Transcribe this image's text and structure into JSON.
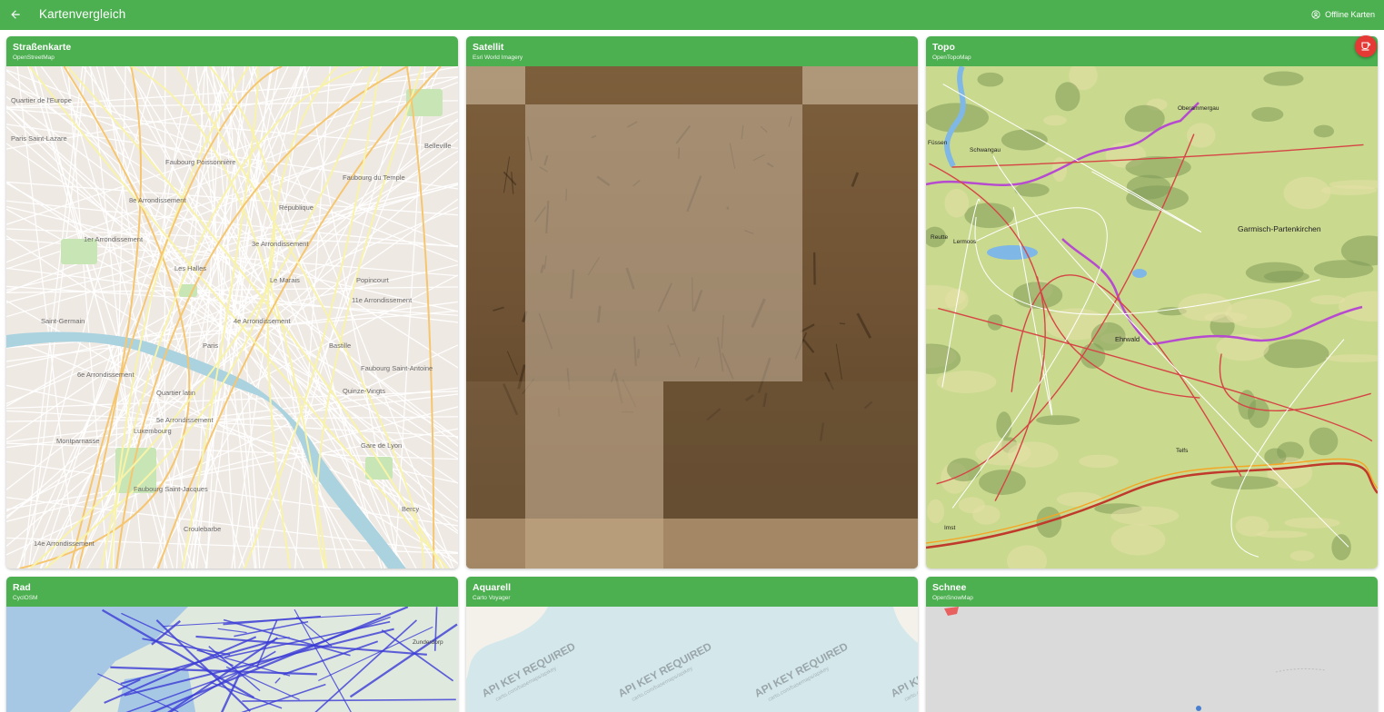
{
  "appbar": {
    "title": "Kartenvergleich",
    "action_label": "Offline Karten",
    "back_icon": "arrow-left-icon",
    "action_icon": "account-circle-icon",
    "color": "#4caf50"
  },
  "fab": {
    "icon": "coffee-cup-icon",
    "color": "#e53935"
  },
  "cards": [
    {
      "name": "Straßenkarte",
      "source": "OpenStreetMap"
    },
    {
      "name": "Satellit",
      "source": "Esri World Imagery"
    },
    {
      "name": "Topo",
      "source": "OpenTopoMap"
    },
    {
      "name": "Rad",
      "source": "CyclOSM"
    },
    {
      "name": "Aquarell",
      "source": "Carto Voyager"
    },
    {
      "name": "Schnee",
      "source": "OpenSnowMap"
    }
  ],
  "street_labels": [
    "Quartier de l'Europe",
    "Paris Saint-Lazare",
    "Faubourg Poissonnière",
    "8e Arrondissement",
    "1er Arrondissement",
    "République",
    "3e Arrondissement",
    "Le Marais",
    "Popincourt",
    "11e Arrondissement",
    "Paris",
    "4e Arrondissement",
    "Bastille",
    "Faubourg Saint-Antoine",
    "6e Arrondissement",
    "Quartier latin",
    "5e Arrondissement",
    "Montparnasse",
    "Luxembourg",
    "Faubourg Saint-Jacques",
    "14e Arrondissement",
    "Croulebarbe",
    "Gare de Lyon",
    "Bercy",
    "Belleville",
    "Faubourg du Temple",
    "Saint-Germain",
    "Les Halles",
    "Quinze-Vingts"
  ],
  "topo_labels": [
    "Garmisch-Partenkirchen",
    "Ehrwald",
    "Oberammergau",
    "Füssen",
    "Reutte",
    "Imst",
    "Telfs",
    "Schwangau",
    "Lermoos"
  ],
  "watermark": "API KEY REQUIRED",
  "watermark_sub": "carto.com/basemaps/apikey"
}
